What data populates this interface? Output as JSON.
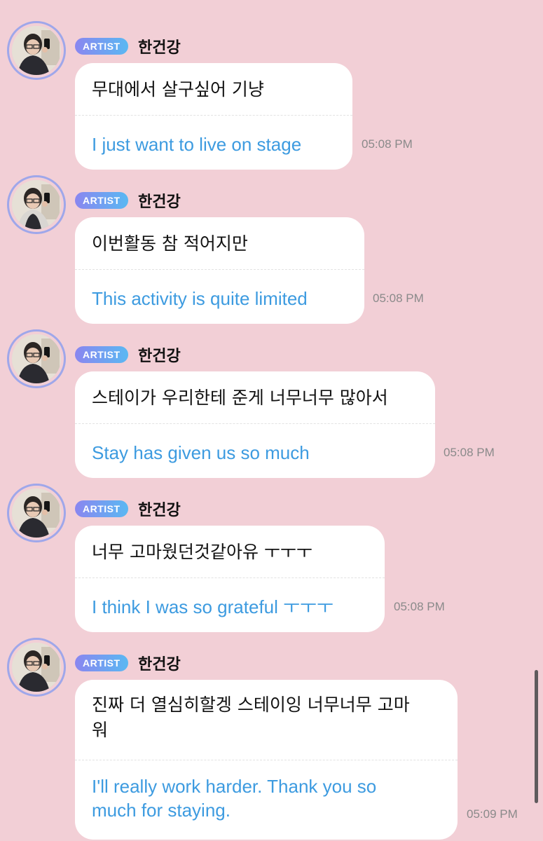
{
  "messages": [
    {
      "badge": "ARTIST",
      "author": "한건강",
      "original": "무대에서 살구싶어 기냥",
      "translation": "I just want to live on stage",
      "time": "05:08 PM"
    },
    {
      "badge": "ARTIST",
      "author": "한건강",
      "original": "이번활동 참 적어지만",
      "translation": "This activity is quite limited",
      "time": "05:08 PM"
    },
    {
      "badge": "ARTIST",
      "author": "한건강",
      "original": "스테이가 우리한테 준게 너무너무 많아서",
      "translation": "Stay has given us so much",
      "time": "05:08 PM"
    },
    {
      "badge": "ARTIST",
      "author": "한건강",
      "original": "너무 고마웠던것같아유 ㅜㅜㅜ",
      "translation": "I think I was so grateful ㅜㅜㅜ",
      "time": "05:08 PM"
    },
    {
      "badge": "ARTIST",
      "author": "한건강",
      "original_line1": "진짜 더 열심히할겡 스테이잉 너무너무 고마",
      "original_line2": "워",
      "translation_line1": "I'll really work harder. Thank you so",
      "translation_line2": "much for staying.",
      "time": "05:09 PM"
    }
  ],
  "colors": {
    "background": "#f2cfd6",
    "bubble": "#ffffff",
    "translation_text": "#3d9be0",
    "badge_gradient_start": "#8a86f0",
    "badge_gradient_end": "#5ab8f2",
    "avatar_ring": "#9fa7ea"
  }
}
